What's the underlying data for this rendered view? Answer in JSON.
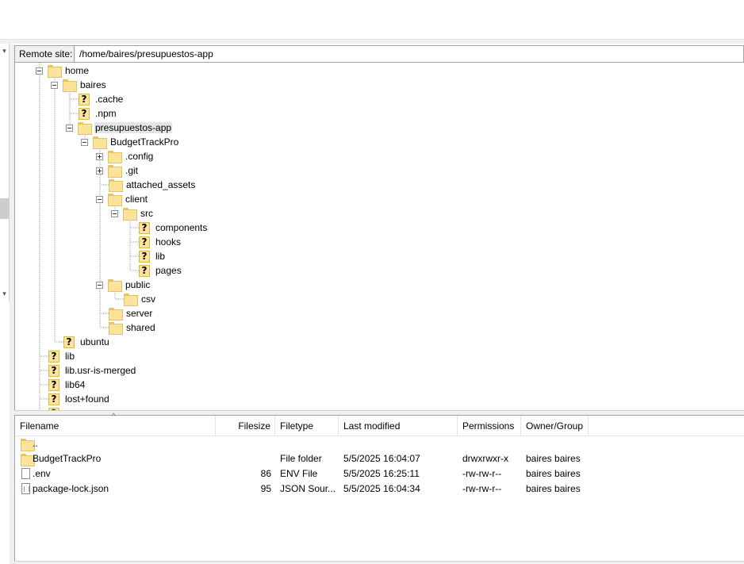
{
  "site_bar": {
    "label": "Remote site:",
    "path": "/home/baires/presupuestos-app"
  },
  "tree": [
    {
      "label": "home",
      "icon": "folder-icon",
      "expander": "minus"
    },
    {
      "label": "baires",
      "icon": "folder-icon",
      "expander": "minus"
    },
    {
      "label": ".cache",
      "icon": "unknown-folder-icon"
    },
    {
      "label": ".npm",
      "icon": "unknown-folder-icon"
    },
    {
      "label": "presupuestos-app",
      "icon": "folder-icon",
      "expander": "minus",
      "selected": true
    },
    {
      "label": "BudgetTrackPro",
      "icon": "folder-icon",
      "expander": "minus"
    },
    {
      "label": ".config",
      "icon": "folder-icon",
      "expander": "plus"
    },
    {
      "label": ".git",
      "icon": "folder-icon",
      "expander": "plus"
    },
    {
      "label": "attached_assets",
      "icon": "folder-icon"
    },
    {
      "label": "client",
      "icon": "folder-icon",
      "expander": "minus"
    },
    {
      "label": "src",
      "icon": "folder-icon",
      "expander": "minus"
    },
    {
      "label": "components",
      "icon": "unknown-folder-icon"
    },
    {
      "label": "hooks",
      "icon": "unknown-folder-icon"
    },
    {
      "label": "lib",
      "icon": "unknown-folder-icon"
    },
    {
      "label": "pages",
      "icon": "unknown-folder-icon"
    },
    {
      "label": "public",
      "icon": "folder-icon",
      "expander": "minus"
    },
    {
      "label": "csv",
      "icon": "folder-icon"
    },
    {
      "label": "server",
      "icon": "folder-icon"
    },
    {
      "label": "shared",
      "icon": "folder-icon"
    },
    {
      "label": "ubuntu",
      "icon": "unknown-folder-icon"
    },
    {
      "label": "lib",
      "icon": "unknown-folder-icon"
    },
    {
      "label": "lib.usr-is-merged",
      "icon": "unknown-folder-icon"
    },
    {
      "label": "lib64",
      "icon": "unknown-folder-icon"
    },
    {
      "label": "lost+found",
      "icon": "unknown-folder-icon"
    }
  ],
  "file_list": {
    "columns": {
      "filename": "Filename",
      "filesize": "Filesize",
      "filetype": "Filetype",
      "modified": "Last modified",
      "permissions": "Permissions",
      "owner": "Owner/Group"
    },
    "rows": [
      {
        "name": "..",
        "size": "",
        "type": "",
        "modified": "",
        "perms": "",
        "owner": "",
        "icon": "folder-icon"
      },
      {
        "name": "BudgetTrackPro",
        "size": "",
        "type": "File folder",
        "modified": "5/5/2025 16:04:07",
        "perms": "drwxrwxr-x",
        "owner": "baires baires",
        "icon": "folder-icon"
      },
      {
        "name": ".env",
        "size": "86",
        "type": "ENV File",
        "modified": "5/5/2025 16:25:11",
        "perms": "-rw-rw-r--",
        "owner": "baires baires",
        "icon": "file-icon"
      },
      {
        "name": "package-lock.json",
        "size": "95",
        "type": "JSON Sour...",
        "modified": "5/5/2025 16:04:34",
        "perms": "-rw-rw-r--",
        "owner": "baires baires",
        "icon": "json-file-icon"
      }
    ]
  },
  "colors": {
    "folder": "#fbe39a",
    "panel_bg": "#f0f0f0",
    "selection": "#e5e5e5"
  }
}
